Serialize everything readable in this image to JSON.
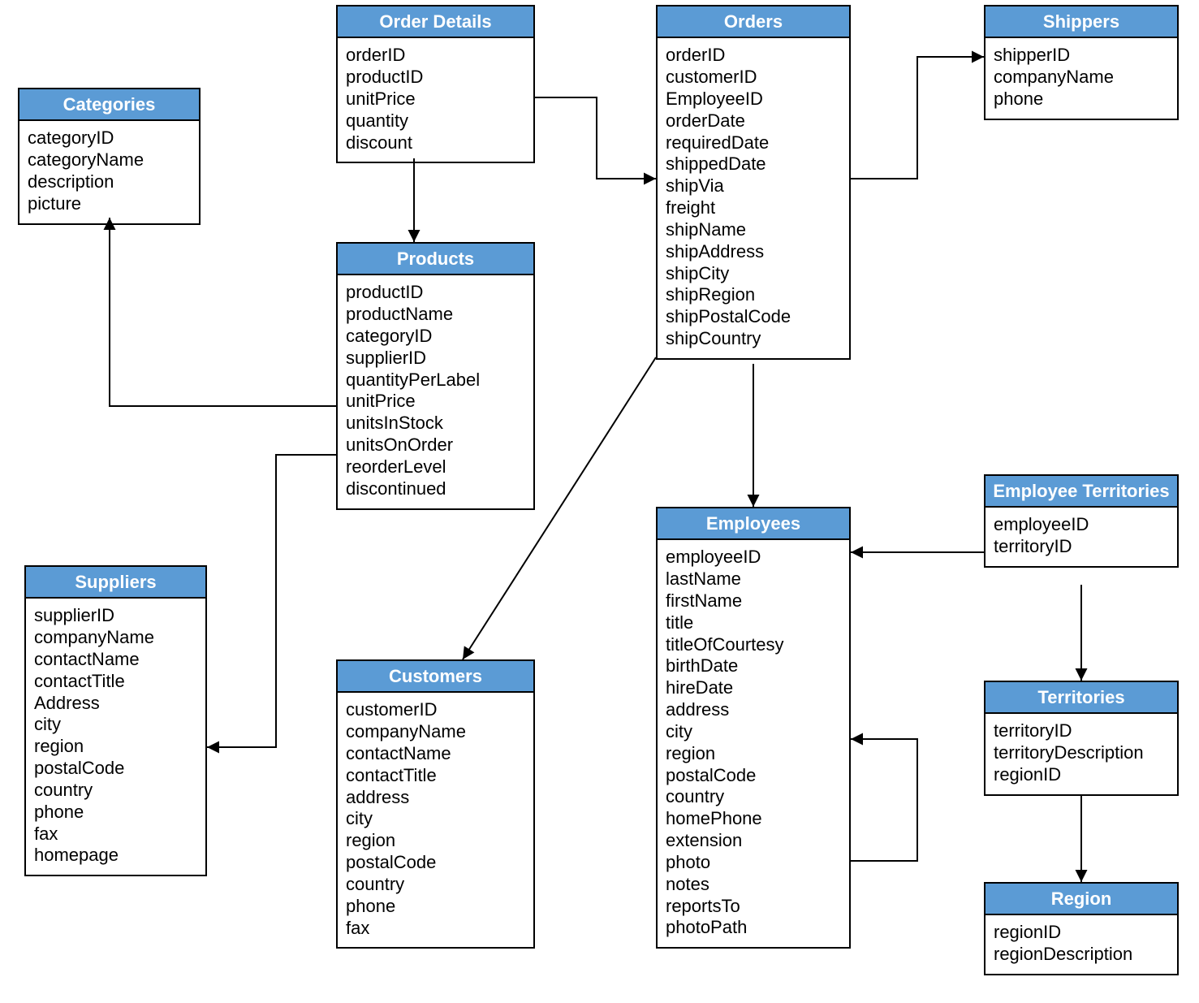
{
  "entities": {
    "categories": {
      "title": "Categories",
      "fields": [
        "categoryID",
        "categoryName",
        "description",
        "picture"
      ]
    },
    "orderDetails": {
      "title": "Order Details",
      "fields": [
        "orderID",
        "productID",
        "unitPrice",
        "quantity",
        "discount"
      ]
    },
    "products": {
      "title": "Products",
      "fields": [
        "productID",
        "productName",
        "categoryID",
        "supplierID",
        "quantityPerLabel",
        "unitPrice",
        "unitsInStock",
        "unitsOnOrder",
        "reorderLevel",
        "discontinued"
      ]
    },
    "suppliers": {
      "title": "Suppliers",
      "fields": [
        "supplierID",
        "companyName",
        "contactName",
        "contactTitle",
        "Address",
        "city",
        "region",
        "postalCode",
        "country",
        "phone",
        "fax",
        "homepage"
      ]
    },
    "customers": {
      "title": "Customers",
      "fields": [
        "customerID",
        "companyName",
        "contactName",
        "contactTitle",
        "address",
        "city",
        "region",
        "postalCode",
        "country",
        "phone",
        "fax"
      ]
    },
    "orders": {
      "title": "Orders",
      "fields": [
        "orderID",
        "customerID",
        "EmployeeID",
        "orderDate",
        "requiredDate",
        "shippedDate",
        "shipVia",
        "freight",
        "shipName",
        "shipAddress",
        "shipCity",
        "shipRegion",
        "shipPostalCode",
        "shipCountry"
      ]
    },
    "shippers": {
      "title": "Shippers",
      "fields": [
        "shipperID",
        "companyName",
        "phone"
      ]
    },
    "employees": {
      "title": "Employees",
      "fields": [
        "employeeID",
        "lastName",
        "firstName",
        "title",
        "titleOfCourtesy",
        "birthDate",
        "hireDate",
        "address",
        "city",
        "region",
        "postalCode",
        "country",
        "homePhone",
        "extension",
        "photo",
        "notes",
        "reportsTo",
        "photoPath"
      ]
    },
    "employeeTerritories": {
      "title": "Employee Territories",
      "fields": [
        "employeeID",
        "territoryID"
      ]
    },
    "territories": {
      "title": "Territories",
      "fields": [
        "territoryID",
        "territoryDescription",
        "regionID"
      ]
    },
    "region": {
      "title": "Region",
      "fields": [
        "regionID",
        "regionDescription"
      ]
    }
  },
  "relationships": [
    {
      "from": "orderDetails",
      "to": "orders"
    },
    {
      "from": "orderDetails",
      "to": "products"
    },
    {
      "from": "products",
      "to": "categories"
    },
    {
      "from": "products",
      "to": "suppliers"
    },
    {
      "from": "orders",
      "to": "shippers"
    },
    {
      "from": "orders",
      "to": "customers"
    },
    {
      "from": "orders",
      "to": "employees"
    },
    {
      "from": "employees",
      "to": "employees",
      "note": "self reportsTo"
    },
    {
      "from": "employeeTerritories",
      "to": "employees"
    },
    {
      "from": "employeeTerritories",
      "to": "territories"
    },
    {
      "from": "territories",
      "to": "region"
    }
  ]
}
